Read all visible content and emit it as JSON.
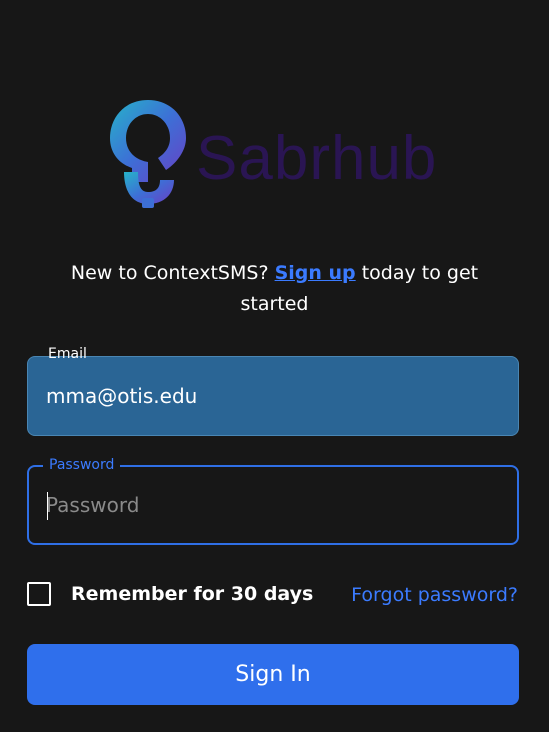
{
  "brand": {
    "logo_icon": "lightbulb-s-icon",
    "name": "Sabrhub"
  },
  "signup": {
    "prefix": "New to ContextSMS?",
    "link_label": "Sign up",
    "suffix": "today to get started"
  },
  "form": {
    "email_label": "Email",
    "email_value": "mma@otis.edu",
    "password_label": "Password",
    "password_placeholder": "Password",
    "remember_label": "Remember for 30 days",
    "forgot_label": "Forgot password?",
    "signin_label": "Sign In"
  },
  "colors": {
    "background": "#171717",
    "accent": "#2f6fec",
    "email_field_bg": "#2a6595",
    "brand_text": "#2a1553"
  }
}
